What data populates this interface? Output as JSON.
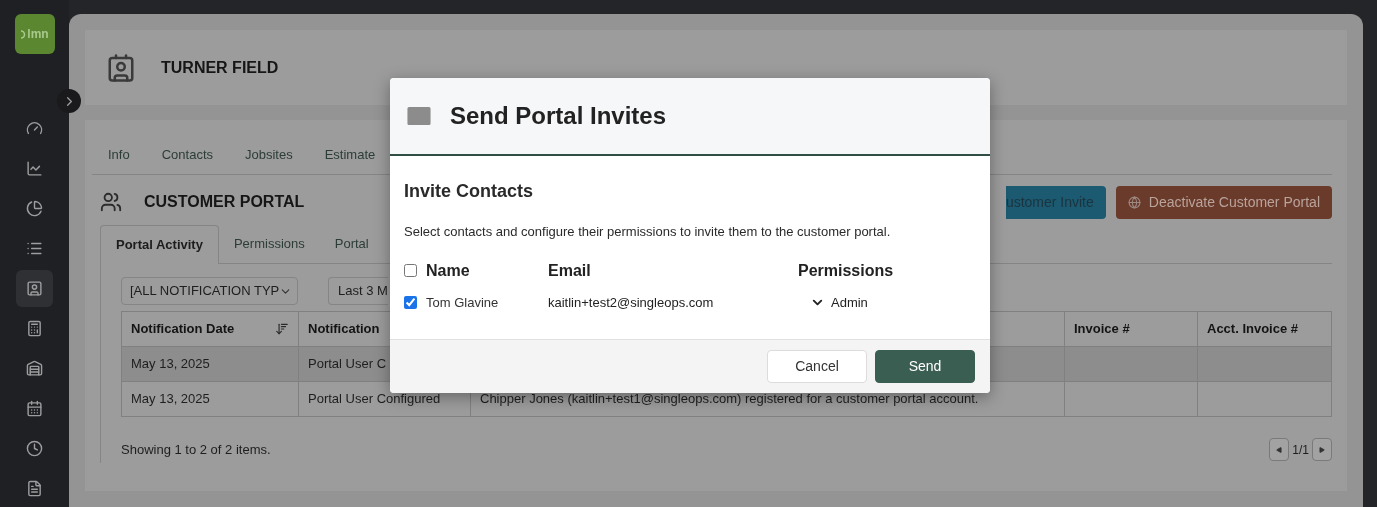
{
  "sidebar": {
    "logo": "lmn",
    "items": [
      {
        "selected": false
      },
      {
        "selected": false
      },
      {
        "selected": false
      },
      {
        "selected": false
      },
      {
        "selected": true
      },
      {
        "selected": false
      },
      {
        "selected": false
      },
      {
        "selected": false
      },
      {
        "selected": false
      },
      {
        "selected": false
      }
    ]
  },
  "header": {
    "title": "TURNER FIELD"
  },
  "tabs": [
    {
      "label": "Info",
      "selected": false
    },
    {
      "label": "Contacts",
      "selected": false
    },
    {
      "label": "Jobsites",
      "selected": false
    },
    {
      "label": "Estimate",
      "selected": false
    }
  ],
  "section": {
    "title": "CUSTOMER PORTAL",
    "buttons": [
      {
        "label": "ustomer Invite",
        "kind": "primary"
      },
      {
        "label": "Deactivate Customer Portal",
        "kind": "danger"
      }
    ]
  },
  "subtabs": [
    {
      "label": "Portal Activity",
      "selected": true
    },
    {
      "label": "Permissions",
      "selected": false
    },
    {
      "label": "Portal",
      "selected": false
    }
  ],
  "filters": [
    {
      "value": "[ALL NOTIFICATION TYP",
      "kind": "dropdown"
    },
    {
      "value": "Last 3 M",
      "kind": "field"
    }
  ],
  "table": {
    "columns": [
      "Notification Date",
      "Notification",
      null,
      "Invoice #",
      "Acct. Invoice #"
    ],
    "rows": [
      {
        "highlighted": true,
        "cells": [
          "May 13, 2025",
          "Portal User C"
        ]
      },
      {
        "highlighted": false,
        "cells": [
          "May 13, 2025",
          "Portal User Configured",
          "Chipper Jones (kaitlin+test1@singleops.com) registered for a customer portal account."
        ]
      }
    ]
  },
  "footer": {
    "summary": "Showing 1 to 2 of 2 items.",
    "page": "1/1"
  },
  "modal": {
    "title": "Send Portal Invites",
    "subtitle": "Invite Contacts",
    "description": "Select contacts and configure their permissions to invite them to the customer portal.",
    "select_all": {
      "checked": false
    },
    "columns": [
      "Name",
      "Email",
      "Permissions"
    ],
    "contacts": [
      {
        "name": "Tom Glavine",
        "email": "kaitlin+test2@singleops.com",
        "permission": "Admin",
        "checked": true
      }
    ],
    "buttons": [
      {
        "label": "Cancel",
        "kind": "secondary"
      },
      {
        "label": "Send",
        "kind": "primary"
      }
    ]
  }
}
